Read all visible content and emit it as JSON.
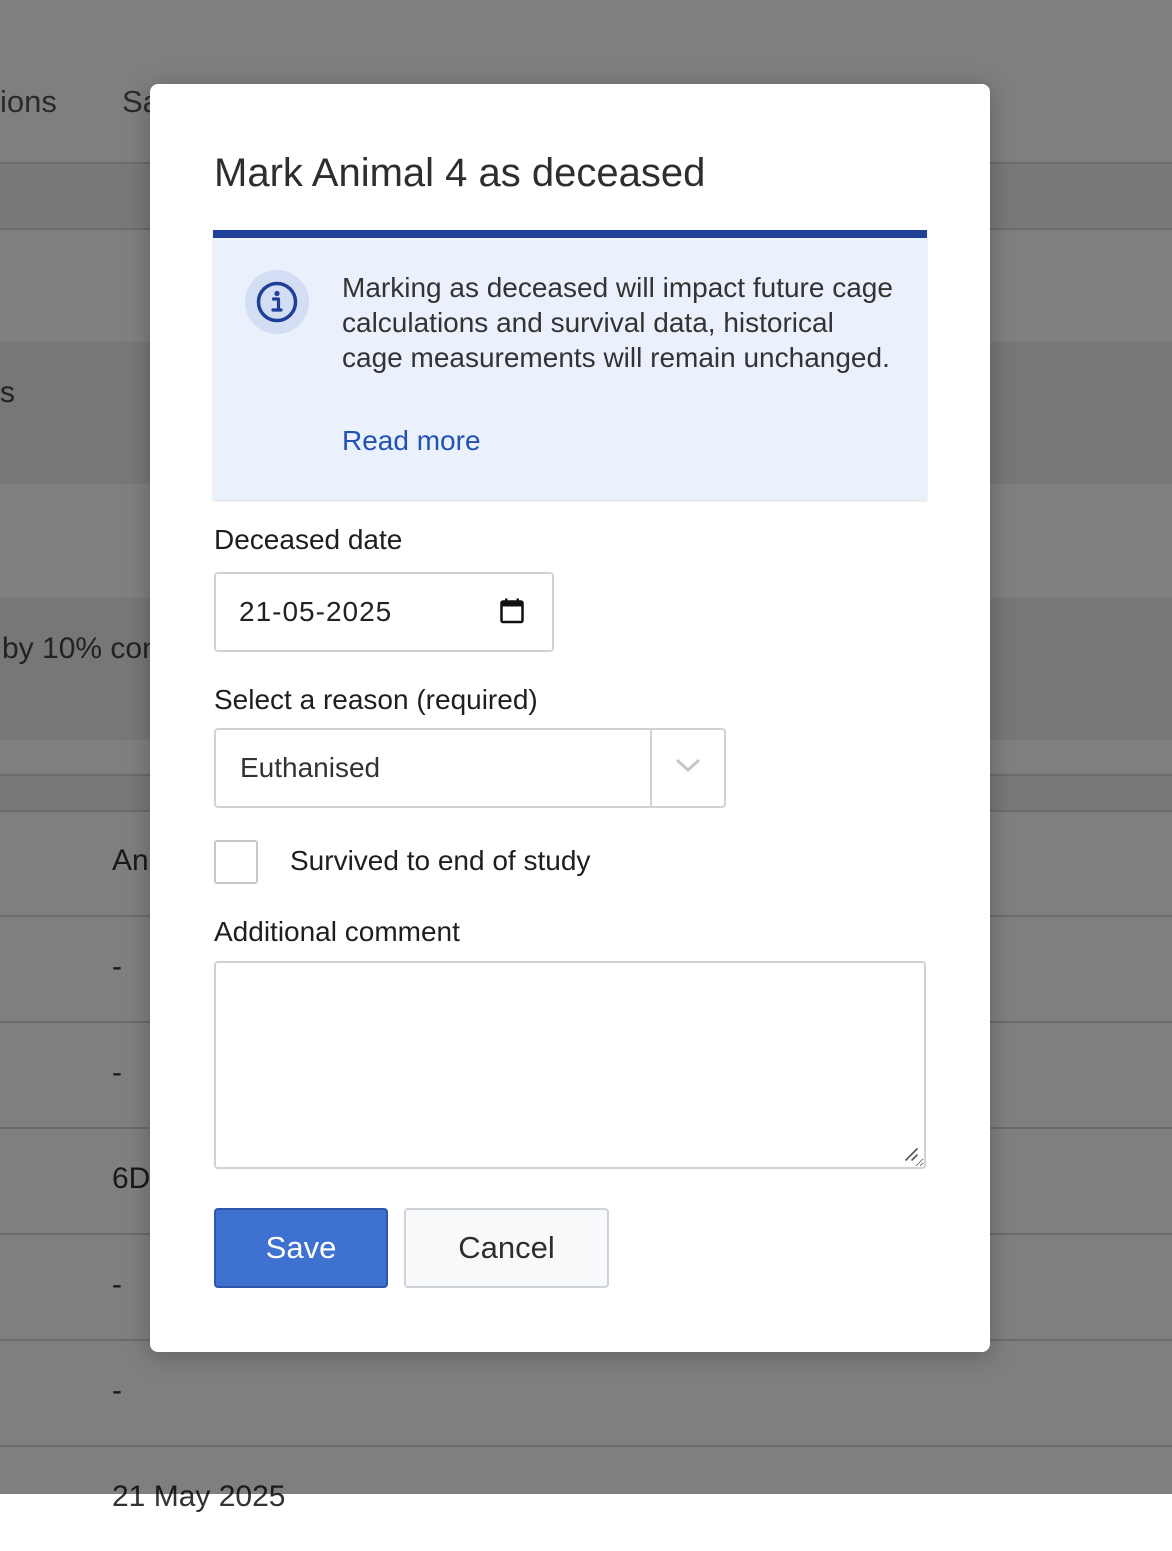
{
  "background": {
    "tabs": [
      "ions",
      "Sa"
    ],
    "row_texts": [
      "s",
      "by 10% con"
    ],
    "table_cells": [
      "An",
      "-",
      "-",
      "6D",
      "-",
      "-",
      "21 May 2025"
    ]
  },
  "modal": {
    "title": "Mark Animal 4 as deceased",
    "info": {
      "icon": "info-icon",
      "message": "Marking as deceased will impact future cage calculations and survival data, historical cage measurements will remain unchanged.",
      "link_label": "Read more"
    },
    "deceased_date": {
      "label": "Deceased date",
      "value": "21-05-2025",
      "icon": "calendar-icon"
    },
    "reason": {
      "label": "Select a reason (required)",
      "selected": "Euthanised",
      "icon": "chevron-down-icon"
    },
    "survived": {
      "label": "Survived to end of study",
      "checked": false
    },
    "comment": {
      "label": "Additional comment",
      "value": ""
    },
    "buttons": {
      "save_label": "Save",
      "cancel_label": "Cancel"
    }
  },
  "colors": {
    "primary": "#3f71d0",
    "info_border": "#1f3f99",
    "info_background": "#eaf1fd",
    "link": "#2351b3",
    "overlay": "rgba(0,0,0,0.5)"
  }
}
